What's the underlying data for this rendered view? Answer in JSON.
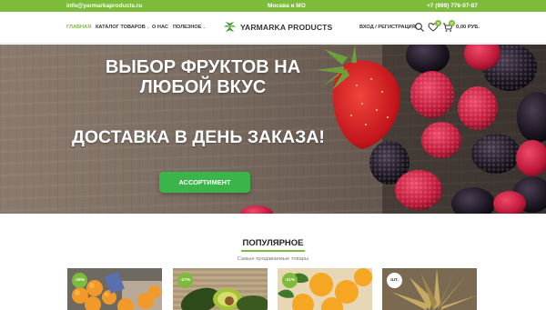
{
  "topbar": {
    "email": "info@yarmarkaproducts.ru",
    "region": "Москва и МО",
    "phone": "+7 (999) 776-07-87"
  },
  "nav": {
    "items": [
      {
        "label": "ГЛАВНАЯ",
        "active": true
      },
      {
        "label": "КАТАЛОГ ТОВАРОВ"
      },
      {
        "label": "О НАС"
      },
      {
        "label": "ПОЛЕЗНОЕ"
      }
    ]
  },
  "logo": {
    "text": "YARMARKA PRODUCTS"
  },
  "account": {
    "login_label": "ВХОД / РЕГИСТРАЦИЯ"
  },
  "header_icons": {
    "search": "search-icon",
    "wishlist": "heart-icon",
    "cart": "cart-icon"
  },
  "wishlist_count": "0",
  "cart": {
    "count": "0",
    "total": "0,00 РУБ."
  },
  "hero": {
    "title": "ВЫБОР ФРУКТОВ НА ЛЮБОЙ ВКУС",
    "subtitle": "ДОСТАВКА В ДЕНЬ ЗАКАЗА!",
    "button_label": "АССОРТИМЕНТ"
  },
  "popular": {
    "title": "ПОПУЛЯРНОЕ",
    "subtitle": "Самые продаваемые товары",
    "products": [
      {
        "badge": "-18%"
      },
      {
        "badge": "-17%"
      },
      {
        "badge": "-21%"
      },
      {
        "badge": "ШТ."
      }
    ]
  },
  "colors": {
    "accent": "#7dbb3a",
    "button": "#3bb54a"
  }
}
